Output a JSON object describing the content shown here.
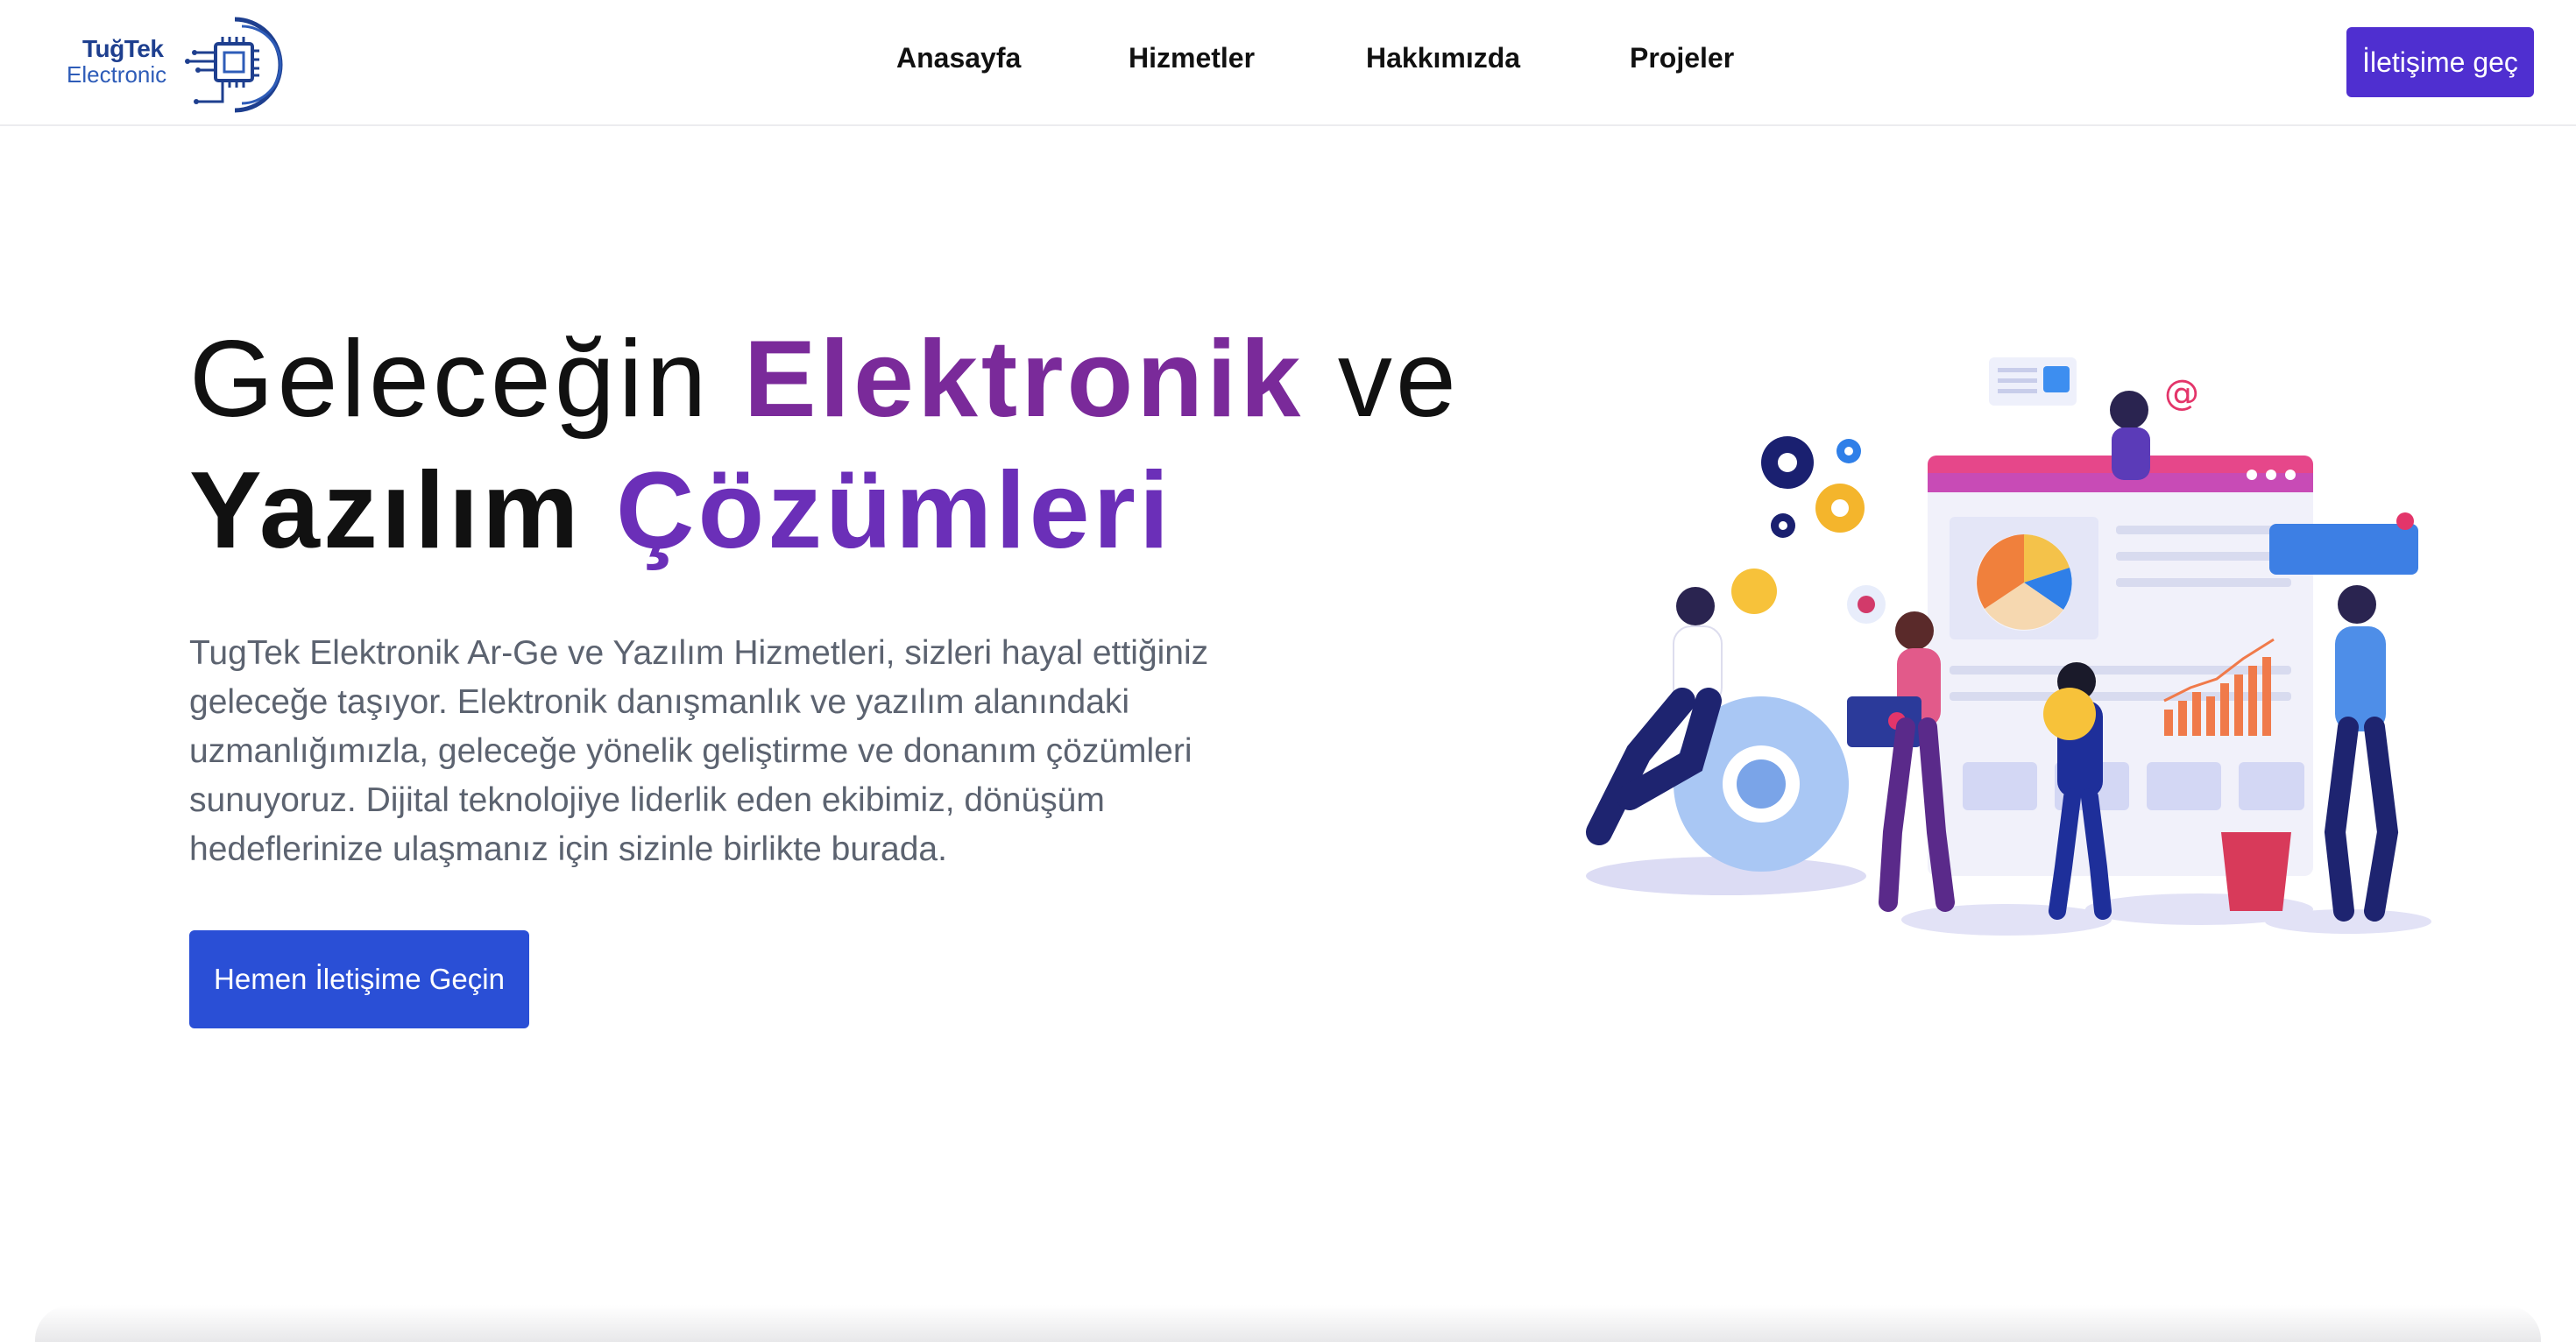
{
  "brand": {
    "line1": "TuğTek",
    "line2": "Electronic"
  },
  "nav": {
    "items": [
      "Anasayfa",
      "Hizmetler",
      "Hakkımızda",
      "Projeler"
    ],
    "cta": "İletişime geç"
  },
  "hero": {
    "title_l1_a": "Geleceğin",
    "title_l1_b": "Elektronik",
    "title_l1_c": "ve",
    "title_l2_a": "Yazılım",
    "title_l2_b": "Çözümleri",
    "description": "TugTek Elektronik Ar-Ge ve Yazılım Hizmetleri, sizleri hayal ettiğiniz geleceğe taşıyor. Elektronik danışmanlık ve yazılım alanındaki uzmanlığımızla, geleceğe yönelik geliştirme ve donanım çözümleri sunuyoruz. Dijital teknolojiye liderlik eden ekibimiz, dönüşüm hedeflerinize ulaşmanız için sizinle birlikte burada.",
    "cta": "Hemen İletişime Geçin"
  },
  "illustration": {
    "at_symbol": "@"
  },
  "colors": {
    "accent_purple": "#7a2a9a",
    "button_indigo": "#4f2fd0",
    "button_blue": "#2a4fd6",
    "text_gray": "#5c6370"
  }
}
